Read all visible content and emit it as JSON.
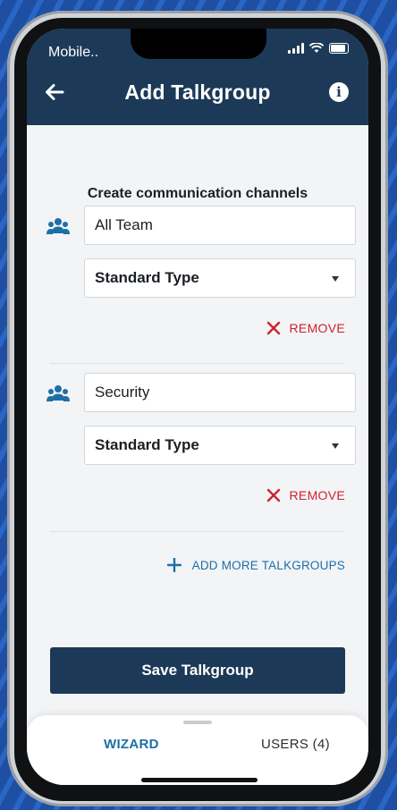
{
  "status_bar": {
    "carrier": "Mobile.."
  },
  "header": {
    "title": "Add Talkgroup",
    "back_icon": "arrow-left-icon",
    "info_icon": "info-icon",
    "info_glyph": "i"
  },
  "main": {
    "subtitle": "Create communication channels",
    "talkgroups": [
      {
        "name": "All Team",
        "type": "Standard Type",
        "remove_label": "REMOVE"
      },
      {
        "name": "Security",
        "type": "Standard Type",
        "remove_label": "REMOVE"
      }
    ],
    "add_more_label": "ADD MORE TALKGROUPS",
    "save_label": "Save Talkgroup"
  },
  "tabs": [
    {
      "label": "WIZARD",
      "active": true
    },
    {
      "label": "USERS (4)",
      "active": false
    }
  ],
  "colors": {
    "header_bg": "#1c3a57",
    "accent_blue": "#1e6fa8",
    "remove_red": "#d0202f",
    "screen_bg": "#f2f4f6"
  }
}
